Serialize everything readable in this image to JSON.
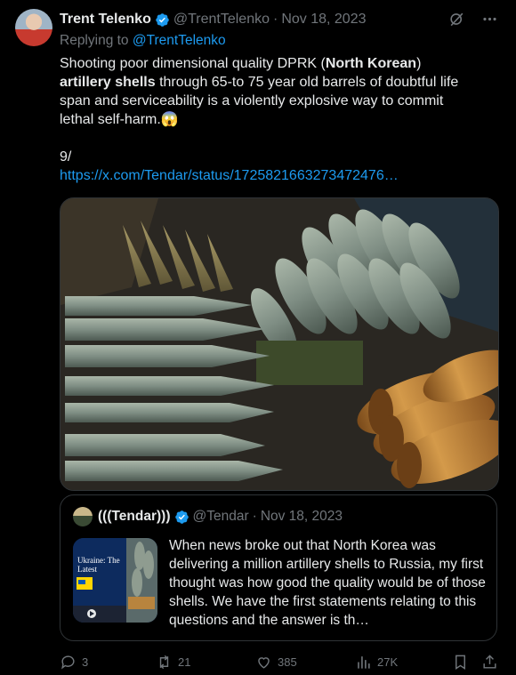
{
  "author": {
    "name": "Trent Telenko",
    "handle": "@TrentTelenko",
    "separator": "·",
    "date": "Nov 18, 2023"
  },
  "replying": {
    "prefix": "Replying to",
    "handle": "@TrentTelenko"
  },
  "body": {
    "line1_a": "Shooting poor dimensional quality DPRK (",
    "line1_bold": "North Korean",
    "line1_b": ")",
    "line2_bold": "artillery shells",
    "line2_rest": " through 65-to 75 year old barrels of doubtful life",
    "line3": "span and serviceability is a violently explosive way to commit",
    "line4": "lethal self-harm.😱",
    "line5": "9/",
    "link": "https://x.com/Tendar/status/1725821663273472476…"
  },
  "quote": {
    "name": "(((Tendar)))",
    "handle": "@Tendar",
    "separator": "·",
    "date": "Nov 18, 2023",
    "text": "When news broke out that North Korea was delivering a million artillery shells to Russia, my first thought was how good the quality would be of those shells. We have the first statements relating to this questions and the answer is th…",
    "thumb_title": "Ukraine: The Latest"
  },
  "actions": {
    "replies": "3",
    "reposts": "21",
    "likes": "385",
    "views": "27K"
  },
  "colors": {
    "background": "#000000",
    "link": "#1d9bf0",
    "muted": "#71767b",
    "border": "#2f3336"
  }
}
